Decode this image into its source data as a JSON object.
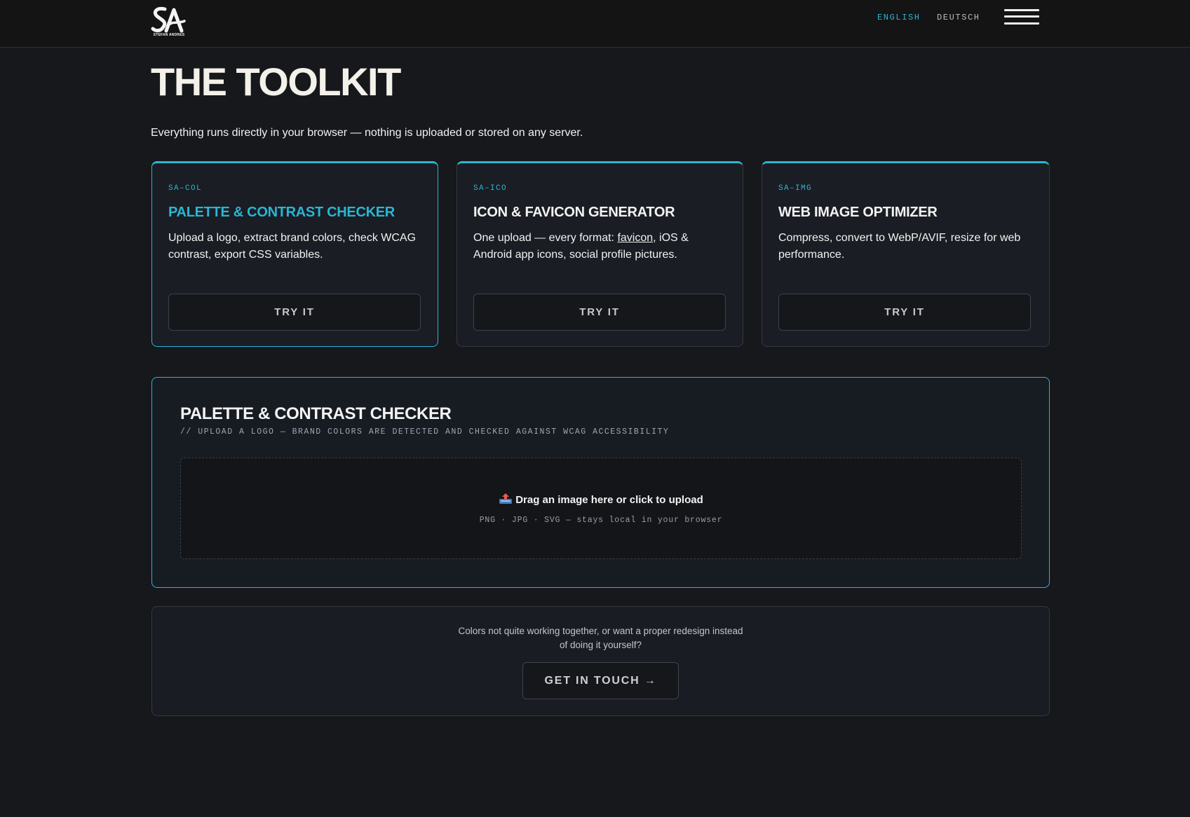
{
  "header": {
    "logo_text": "STEFAN ANDRES",
    "languages": [
      {
        "label": "ENGLISH",
        "active": true
      },
      {
        "label": "DEUTSCH",
        "active": false
      }
    ],
    "menu_icon": "hamburger-menu-icon"
  },
  "page": {
    "title": "THE TOOLKIT",
    "intro": "Everything runs directly in your browser — nothing is uploaded or stored on any server."
  },
  "tools": [
    {
      "code": "SA–COL",
      "title": "PALETTE & CONTRAST CHECKER",
      "description": "Upload a logo, extract brand colors, check WCAG contrast, export CSS variables.",
      "button": "TRY IT",
      "active": true
    },
    {
      "code": "SA–ICO",
      "title": "ICON & FAVICON GENERATOR",
      "description_before": "One upload — every format: ",
      "description_link": "favicon",
      "description_after": ", iOS & Android app icons, social profile pictures.",
      "button": "TRY IT",
      "active": false
    },
    {
      "code": "SA–IMG",
      "title": "WEB IMAGE OPTIMIZER",
      "description": "Compress, convert to WebP/AVIF, resize for web performance.",
      "button": "TRY IT",
      "active": false
    }
  ],
  "panel": {
    "title": "PALETTE & CONTRAST CHECKER",
    "subtitle": "// UPLOAD A LOGO — BRAND COLORS ARE DETECTED AND CHECKED AGAINST WCAG ACCESSIBILITY",
    "dropzone": {
      "icon": "upload-tray-icon",
      "main": "Drag an image here or click to upload",
      "hint": "PNG · JPG · SVG — stays local in your browser"
    }
  },
  "cta": {
    "text": "Colors not quite working together, or want a proper redesign instead of doing it yourself?",
    "button": "GET IN TOUCH →"
  },
  "colors": {
    "accent": "#29b6d4",
    "background": "#16181b",
    "card": "#1a1d23",
    "border": "#343a42"
  }
}
